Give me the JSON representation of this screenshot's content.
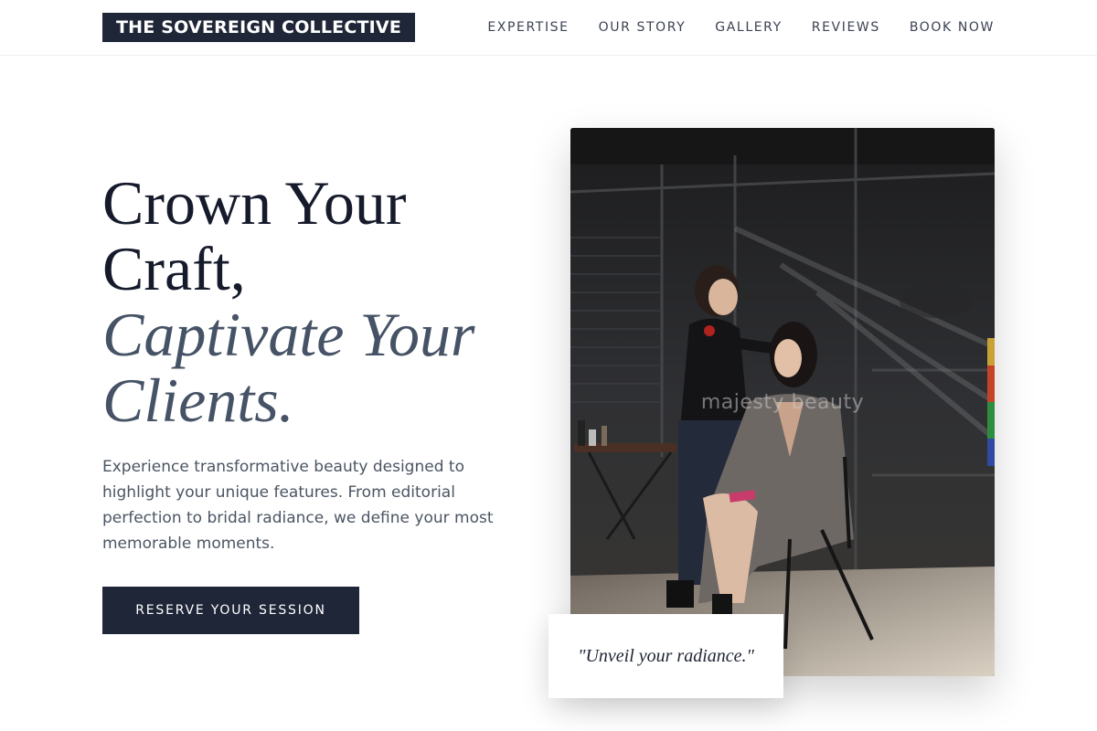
{
  "brand": {
    "name": "THE SOVEREIGN COLLECTIVE"
  },
  "nav": {
    "items": [
      "EXPERTISE",
      "OUR STORY",
      "GALLERY",
      "REVIEWS",
      "BOOK NOW"
    ]
  },
  "hero": {
    "headline_line1": "Crown Your",
    "headline_line2": "Craft,",
    "headline_line3": "Captivate Your",
    "headline_line4": "Clients.",
    "description": "Experience transformative beauty designed to highlight your unique features. From editorial perfection to bridal radiance, we define your most memorable moments.",
    "cta_label": "RESERVE YOUR SESSION"
  },
  "photo": {
    "watermark": "majesty beauty"
  },
  "quote": {
    "text": "\"Unveil your radiance.\""
  },
  "colors": {
    "navy": "#1f2638",
    "slate_italic": "#465366",
    "body_text": "#4b5563"
  }
}
